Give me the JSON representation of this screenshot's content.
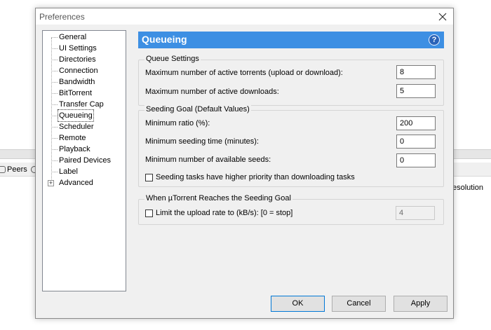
{
  "background": {
    "peers_tab": "Peers",
    "resolution_col": "esolution"
  },
  "window": {
    "title": "Preferences"
  },
  "tree": {
    "items": [
      {
        "label": "General"
      },
      {
        "label": "UI Settings"
      },
      {
        "label": "Directories"
      },
      {
        "label": "Connection"
      },
      {
        "label": "Bandwidth"
      },
      {
        "label": "BitTorrent"
      },
      {
        "label": "Transfer Cap"
      },
      {
        "label": "Queueing",
        "selected": true
      },
      {
        "label": "Scheduler"
      },
      {
        "label": "Remote"
      },
      {
        "label": "Playback"
      },
      {
        "label": "Paired Devices"
      },
      {
        "label": "Label"
      },
      {
        "label": "Advanced",
        "expandable": true
      }
    ]
  },
  "header": {
    "title": "Queueing",
    "help_glyph": "?"
  },
  "queue_settings": {
    "title": "Queue Settings",
    "max_active_torrents_label": "Maximum number of active torrents (upload or download):",
    "max_active_torrents_value": "8",
    "max_active_downloads_label": "Maximum number of active downloads:",
    "max_active_downloads_value": "5"
  },
  "seeding_goal": {
    "title": "Seeding Goal (Default Values)",
    "min_ratio_label": "Minimum ratio (%):",
    "min_ratio_value": "200",
    "min_seed_time_label": "Minimum seeding time (minutes):",
    "min_seed_time_value": "0",
    "min_seeds_label": "Minimum number of available seeds:",
    "min_seeds_value": "0",
    "priority_checkbox_label": "Seeding tasks have higher priority than downloading tasks",
    "priority_checked": false
  },
  "reached_goal": {
    "title": "When µTorrent Reaches the Seeding Goal",
    "limit_checkbox_label": "Limit the upload rate to (kB/s): [0 = stop]",
    "limit_checked": false,
    "limit_value": "4"
  },
  "buttons": {
    "ok": "OK",
    "cancel": "Cancel",
    "apply": "Apply"
  },
  "colors": {
    "header_bg": "#3d8fe3",
    "dialog_bg": "#f0f0f0"
  }
}
